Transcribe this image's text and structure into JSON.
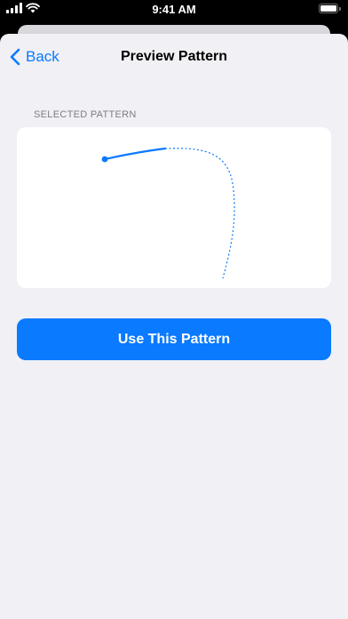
{
  "status_bar": {
    "time": "9:41 AM",
    "icons": [
      "cellular-signal-icon",
      "wifi-icon",
      "battery-icon"
    ]
  },
  "nav": {
    "back_label": "Back",
    "title": "Preview Pattern"
  },
  "section": {
    "label": "SELECTED PATTERN"
  },
  "pattern": {
    "stroke_color": "#0a7aff"
  },
  "primary_action": {
    "label": "Use This Pattern"
  },
  "colors": {
    "accent": "#0a7aff",
    "background": "#f0f0f5",
    "card": "#ffffff",
    "secondary_text": "#7c7c82"
  }
}
